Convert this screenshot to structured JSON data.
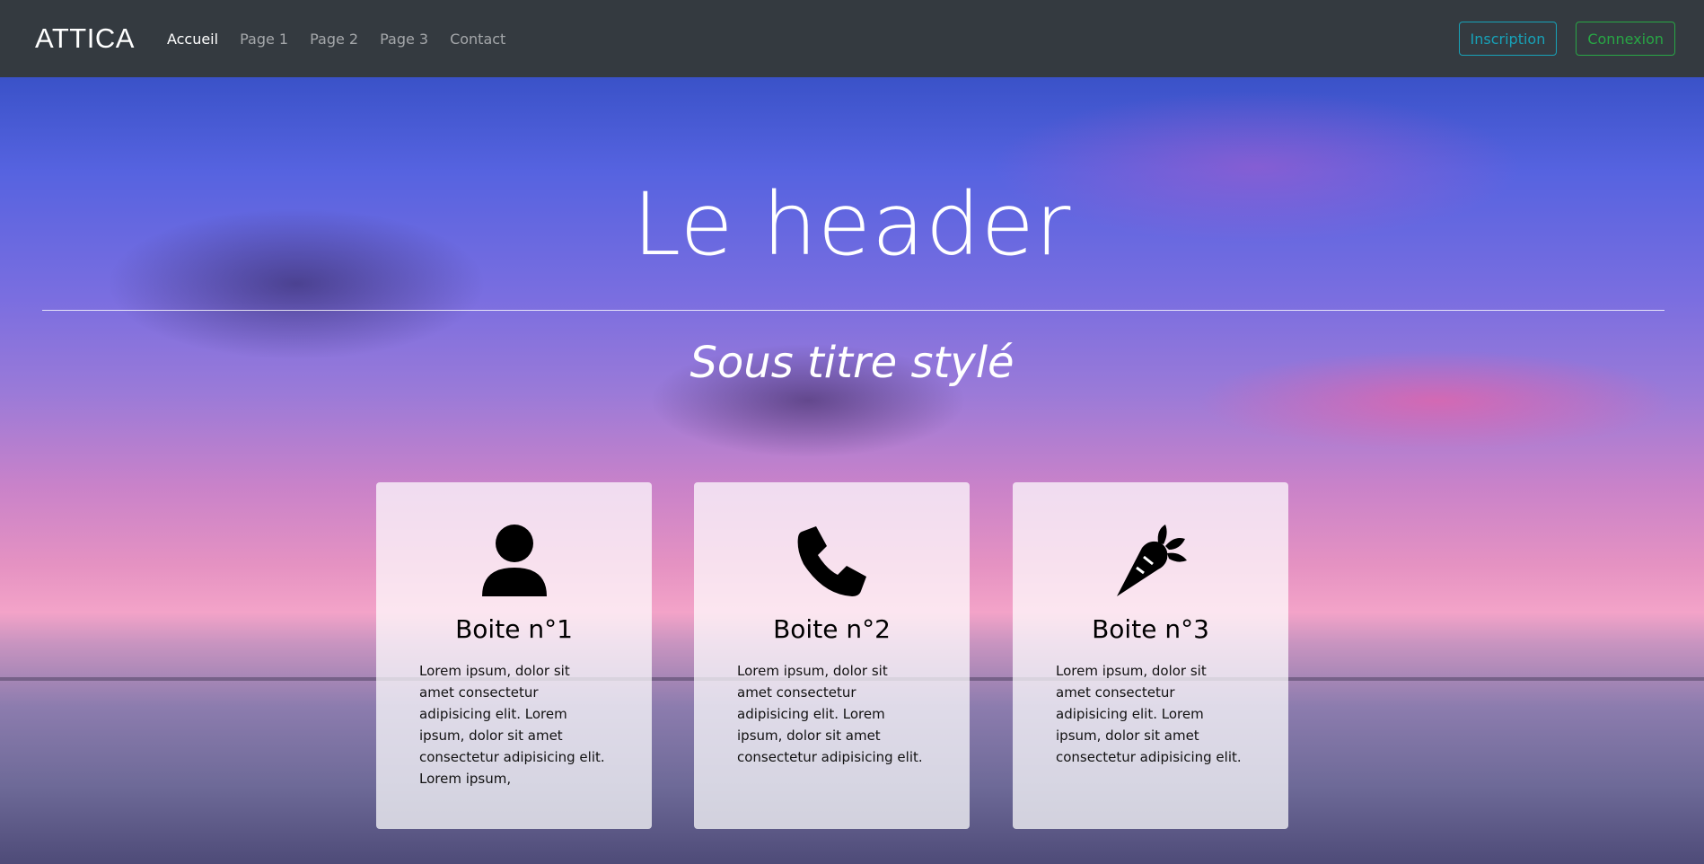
{
  "navbar": {
    "brand": "ATTICA",
    "links": [
      {
        "label": "Accueil",
        "active": true
      },
      {
        "label": "Page 1",
        "active": false
      },
      {
        "label": "Page 2",
        "active": false
      },
      {
        "label": "Page 3",
        "active": false
      },
      {
        "label": "Contact",
        "active": false
      }
    ],
    "buttons": {
      "signup": "Inscription",
      "login": "Connexion"
    },
    "colors": {
      "background": "#343a40",
      "signup_accent": "#17a2b8",
      "login_accent": "#28a745"
    }
  },
  "hero": {
    "title": "Le header",
    "subtitle": "Sous titre stylé"
  },
  "cards": [
    {
      "icon": "user-icon",
      "title": "Boite n°1",
      "text": "Lorem ipsum, dolor sit amet consectetur adipisicing elit. Lorem ipsum, dolor sit amet consectetur adipisicing elit. Lorem ipsum,"
    },
    {
      "icon": "phone-icon",
      "title": "Boite n°2",
      "text": "Lorem ipsum, dolor sit amet consectetur adipisicing elit. Lorem ipsum, dolor sit amet consectetur adipisicing elit."
    },
    {
      "icon": "carrot-icon",
      "title": "Boite n°3",
      "text": "Lorem ipsum, dolor sit amet consectetur adipisicing elit. Lorem ipsum, dolor sit amet consectetur adipisicing elit."
    }
  ]
}
